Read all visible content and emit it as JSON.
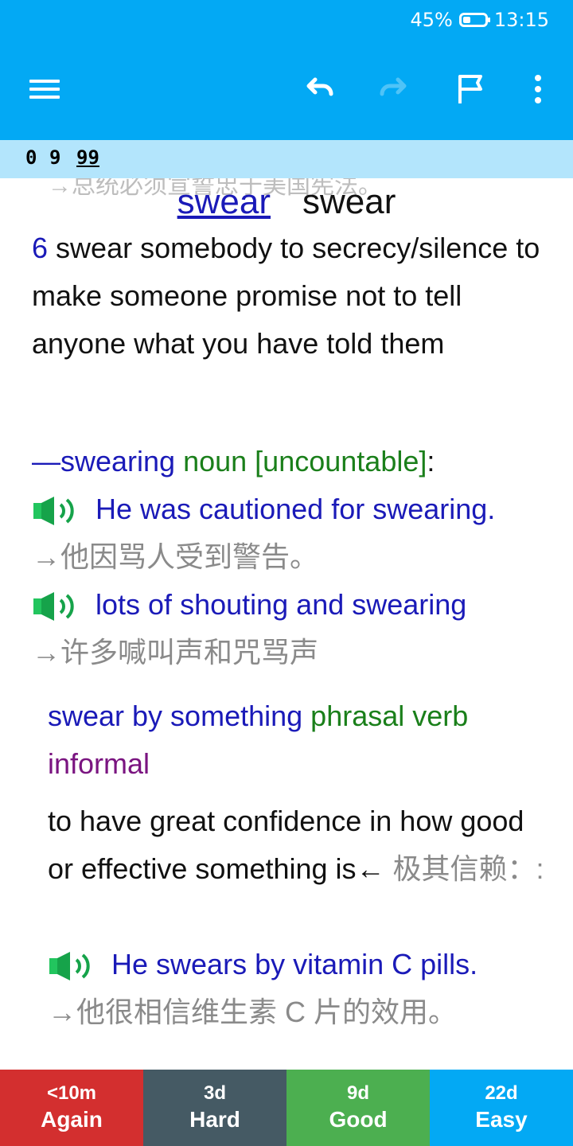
{
  "status_bar": {
    "battery": "45%",
    "time": "13:15"
  },
  "toolbar": {
    "menu_icon": "hamburger-menu-icon",
    "undo_icon": "undo-icon",
    "redo_icon": "redo-icon",
    "flag_icon": "flag-icon",
    "overflow_icon": "more-vert-icon",
    "color": "#03A9F4"
  },
  "counts": {
    "new": "0",
    "learning": "9",
    "review": "99"
  },
  "card": {
    "ghost_text": "→总统必须宣誓忠于美国宪法。",
    "headword_link": "swear",
    "headword_plain": "swear",
    "sense_number": "6",
    "definition": "swear somebody to secrecy/silence to make someone promise not to tell anyone what you have told them",
    "derived": {
      "word": "—swearing",
      "pos": "noun [uncountable]",
      "colon": ":",
      "examples": [
        {
          "en": "He was cautioned for swearing.",
          "zh": "→他因骂人受到警告。"
        },
        {
          "en": "lots of shouting and swearing",
          "zh": "→许多喊叫声和咒骂声"
        }
      ]
    },
    "phrasal": {
      "phrase": "swear by something",
      "pos": "phrasal verb",
      "register": "informal",
      "definition": "to have great confidence in how good or effective something is←",
      "definition_zh": "极其信赖：:",
      "example_en": "He swears by vitamin C pills.",
      "example_zh": "→他很相信维生素 C 片的效用。"
    }
  },
  "answer_buttons": [
    {
      "interval": "<10m",
      "label": "Again",
      "color": "#D32F2F"
    },
    {
      "interval": "3d",
      "label": "Hard",
      "color": "#455A64"
    },
    {
      "interval": "9d",
      "label": "Good",
      "color": "#4CAF50"
    },
    {
      "interval": "22d",
      "label": "Easy",
      "color": "#03A9F4"
    }
  ]
}
